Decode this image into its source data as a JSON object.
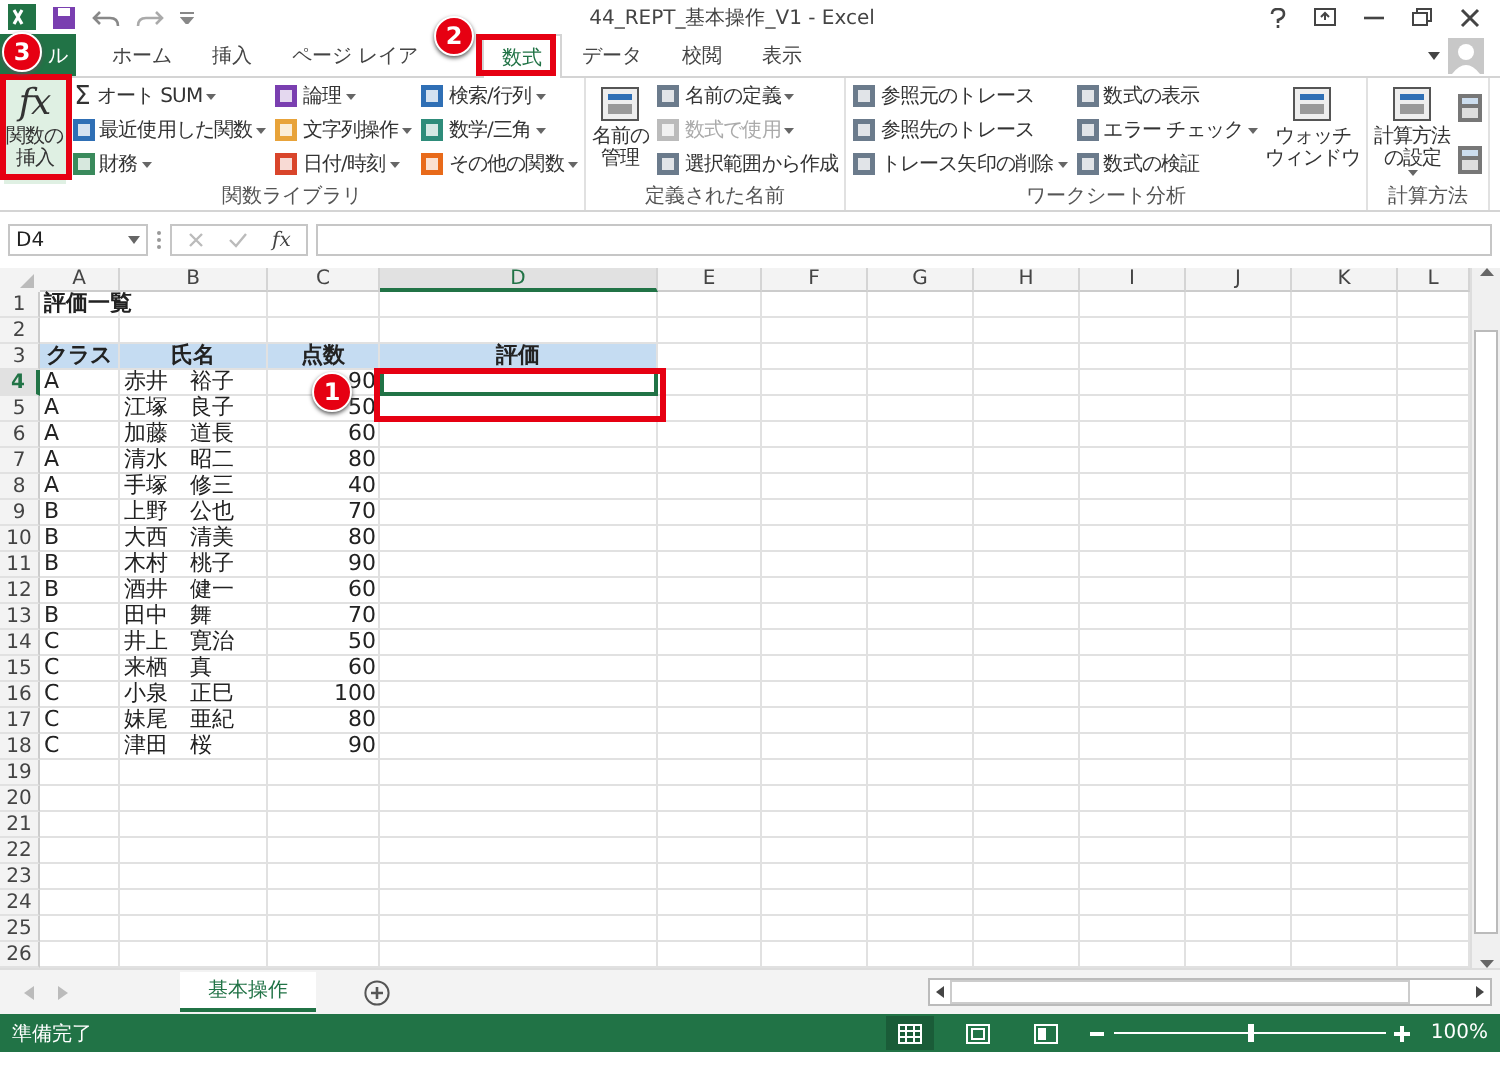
{
  "window": {
    "title": "44_REPT_基本操作_V1 - Excel"
  },
  "tabs": [
    {
      "label": "ル",
      "kind": "file"
    },
    {
      "label": "ホーム",
      "kind": "tab",
      "selected": false
    },
    {
      "label": "挿入",
      "kind": "tab",
      "selected": false
    },
    {
      "label": "ページ レイア",
      "kind": "tab",
      "selected": false
    },
    {
      "label": "数式",
      "kind": "tab",
      "selected": true
    },
    {
      "label": "データ",
      "kind": "tab",
      "selected": false
    },
    {
      "label": "校閲",
      "kind": "tab",
      "selected": false
    },
    {
      "label": "表示",
      "kind": "tab",
      "selected": false
    }
  ],
  "ribbon": {
    "groups": [
      {
        "label": "関数ライブラリ",
        "parts": [
          {
            "kind": "large",
            "lines": [
              "関数の",
              "挿入"
            ],
            "glyph": "fx",
            "dropdown": false
          },
          {
            "kind": "column",
            "buttons": [
              {
                "label": "オート SUM",
                "glyph": "Σ",
                "dropdown": true,
                "disabled": false
              },
              {
                "label": "最近使用した関数",
                "color": "#2f6fb5",
                "dropdown": true,
                "disabled": false
              },
              {
                "label": "財務",
                "color": "#3a8a5c",
                "dropdown": true,
                "disabled": false
              }
            ]
          },
          {
            "kind": "column",
            "buttons": [
              {
                "label": "論理",
                "color": "#7a3fb0",
                "dropdown": true,
                "disabled": false
              },
              {
                "label": "文字列操作",
                "color": "#e8a33a",
                "dropdown": true,
                "disabled": false
              },
              {
                "label": "日付/時刻",
                "color": "#d9452b",
                "dropdown": true,
                "disabled": false
              }
            ]
          },
          {
            "kind": "column",
            "buttons": [
              {
                "label": "検索/行列",
                "color": "#2f6fb5",
                "dropdown": true,
                "disabled": false
              },
              {
                "label": "数学/三角",
                "color": "#2e8c7a",
                "dropdown": true,
                "disabled": false
              },
              {
                "label": "その他の関数",
                "color": "#e86a1a",
                "dropdown": true,
                "disabled": false
              }
            ]
          }
        ]
      },
      {
        "label": "定義された名前",
        "parts": [
          {
            "kind": "large",
            "lines": [
              "名前の",
              "管理"
            ],
            "dropdown": false
          },
          {
            "kind": "column",
            "buttons": [
              {
                "label": "名前の定義",
                "dropdown": true,
                "disabled": false
              },
              {
                "label": "数式で使用",
                "dropdown": true,
                "disabled": true
              },
              {
                "label": "選択範囲から作成",
                "dropdown": false,
                "disabled": false
              }
            ]
          }
        ]
      },
      {
        "label": "ワークシート分析",
        "parts": [
          {
            "kind": "column",
            "buttons": [
              {
                "label": "参照元のトレース",
                "dropdown": false,
                "disabled": false
              },
              {
                "label": "参照先のトレース",
                "dropdown": false,
                "disabled": false
              },
              {
                "label": "トレース矢印の削除",
                "dropdown": true,
                "disabled": false
              }
            ]
          },
          {
            "kind": "column",
            "buttons": [
              {
                "label": "数式の表示",
                "dropdown": false,
                "disabled": false
              },
              {
                "label": "エラー チェック",
                "dropdown": true,
                "disabled": false
              },
              {
                "label": "数式の検証",
                "dropdown": false,
                "disabled": false
              }
            ]
          },
          {
            "kind": "large",
            "lines": [
              "ウォッチ",
              "ウィンドウ"
            ],
            "dropdown": false
          }
        ]
      },
      {
        "label": "計算方法",
        "parts": [
          {
            "kind": "large",
            "lines": [
              "計算方法",
              "の設定"
            ],
            "dropdown": true
          },
          {
            "kind": "icons"
          }
        ]
      }
    ]
  },
  "formula_bar": {
    "name_box": "D4",
    "fx": "fx"
  },
  "columns": [
    {
      "label": "A",
      "selected": false
    },
    {
      "label": "B",
      "selected": false
    },
    {
      "label": "C",
      "selected": false
    },
    {
      "label": "D",
      "selected": true
    },
    {
      "label": "E",
      "selected": false
    },
    {
      "label": "F",
      "selected": false
    },
    {
      "label": "G",
      "selected": false
    },
    {
      "label": "H",
      "selected": false
    },
    {
      "label": "I",
      "selected": false
    },
    {
      "label": "J",
      "selected": false
    },
    {
      "label": "K",
      "selected": false
    },
    {
      "label": "L",
      "selected": false
    }
  ],
  "rows": [
    {
      "number": "1",
      "kind": "title",
      "selected": false,
      "title": "評価一覧"
    },
    {
      "number": "2",
      "kind": "empty",
      "selected": false
    },
    {
      "number": "3",
      "kind": "header",
      "selected": false,
      "class": "クラス",
      "name": "氏名",
      "score": "点数",
      "rating": "評価"
    },
    {
      "number": "4",
      "kind": "data",
      "selected": true,
      "class": "A",
      "name": "赤井　裕子",
      "score": "90"
    },
    {
      "number": "5",
      "kind": "data",
      "selected": false,
      "class": "A",
      "name": "江塚　良子",
      "score": "50"
    },
    {
      "number": "6",
      "kind": "data",
      "selected": false,
      "class": "A",
      "name": "加藤　道長",
      "score": "60"
    },
    {
      "number": "7",
      "kind": "data",
      "selected": false,
      "class": "A",
      "name": "清水　昭二",
      "score": "80"
    },
    {
      "number": "8",
      "kind": "data",
      "selected": false,
      "class": "A",
      "name": "手塚　修三",
      "score": "40"
    },
    {
      "number": "9",
      "kind": "data",
      "selected": false,
      "class": "B",
      "name": "上野　公也",
      "score": "70"
    },
    {
      "number": "10",
      "kind": "data",
      "selected": false,
      "class": "B",
      "name": "大西　清美",
      "score": "80"
    },
    {
      "number": "11",
      "kind": "data",
      "selected": false,
      "class": "B",
      "name": "木村　桃子",
      "score": "90"
    },
    {
      "number": "12",
      "kind": "data",
      "selected": false,
      "class": "B",
      "name": "酒井　健一",
      "score": "60"
    },
    {
      "number": "13",
      "kind": "data",
      "selected": false,
      "class": "B",
      "name": "田中　舞",
      "score": "70"
    },
    {
      "number": "14",
      "kind": "data",
      "selected": false,
      "class": "C",
      "name": "井上　寛治",
      "score": "50"
    },
    {
      "number": "15",
      "kind": "data",
      "selected": false,
      "class": "C",
      "name": "来栖　真",
      "score": "60"
    },
    {
      "number": "16",
      "kind": "data",
      "selected": false,
      "class": "C",
      "name": "小泉　正巳",
      "score": "100"
    },
    {
      "number": "17",
      "kind": "data",
      "selected": false,
      "class": "C",
      "name": "妹尾　亜紀",
      "score": "80"
    },
    {
      "number": "18",
      "kind": "data",
      "selected": false,
      "class": "C",
      "name": "津田　桜",
      "score": "90"
    },
    {
      "number": "19",
      "kind": "empty",
      "selected": false
    },
    {
      "number": "20",
      "kind": "empty",
      "selected": false
    },
    {
      "number": "21",
      "kind": "empty",
      "selected": false
    },
    {
      "number": "22",
      "kind": "empty",
      "selected": false
    },
    {
      "number": "23",
      "kind": "empty",
      "selected": false
    },
    {
      "number": "24",
      "kind": "empty",
      "selected": false
    },
    {
      "number": "25",
      "kind": "empty",
      "selected": false
    },
    {
      "number": "26",
      "kind": "empty",
      "selected": false
    }
  ],
  "sheets": [
    {
      "label": "基本操作",
      "selected": true
    }
  ],
  "status_bar": {
    "text": "準備完了",
    "views": [
      {
        "kind": "normal",
        "selected": true
      },
      {
        "kind": "page-layout",
        "selected": false
      },
      {
        "kind": "page-break",
        "selected": false
      }
    ],
    "zoom": {
      "level": 0.5,
      "label": "100%"
    }
  },
  "callouts": [
    {
      "number": "1"
    },
    {
      "number": "2"
    },
    {
      "number": "3"
    }
  ]
}
